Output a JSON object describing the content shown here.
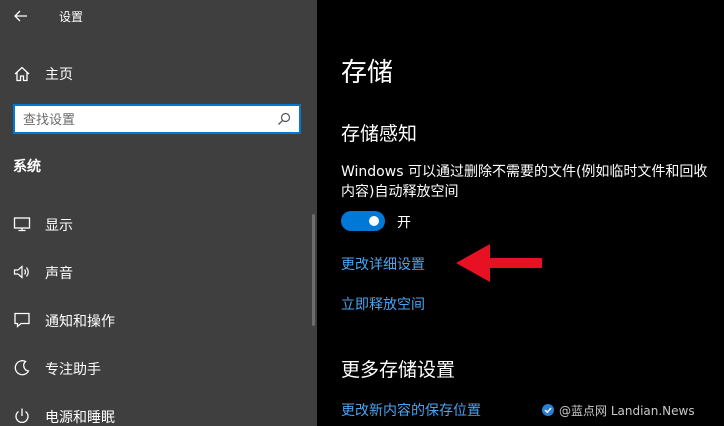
{
  "app": {
    "title": "设置",
    "back_icon": "back-arrow-icon"
  },
  "sidebar": {
    "home_label": "主页",
    "search_placeholder": "查找设置",
    "section_title": "系统",
    "items": [
      {
        "label": "显示",
        "icon": "display-icon"
      },
      {
        "label": "声音",
        "icon": "speaker-icon"
      },
      {
        "label": "通知和操作",
        "icon": "notification-icon"
      },
      {
        "label": "专注助手",
        "icon": "focus-assist-icon"
      },
      {
        "label": "电源和睡眠",
        "icon": "power-icon"
      }
    ]
  },
  "main": {
    "page_title": "存储",
    "storage_sense": {
      "heading": "存储感知",
      "description_line1": "Windows 可以通过删除不需要的文件(例如临时文件和回收",
      "description_line2": "内容)自动释放空间",
      "toggle_state": "开",
      "toggle_on": true,
      "link_configure": "更改详细设置",
      "link_free_now": "立即释放空间"
    },
    "more_storage": {
      "heading": "更多存储设置",
      "link_save_location": "更改新内容的保存位置"
    }
  },
  "annotation": {
    "arrow_color": "#e81123"
  },
  "watermark": {
    "text": "@蓝点网 Landian.News"
  },
  "colors": {
    "accent": "#0078d7",
    "link": "#4aa3ef",
    "sidebar_bg": "#3f3f3f",
    "main_bg": "#000000"
  }
}
